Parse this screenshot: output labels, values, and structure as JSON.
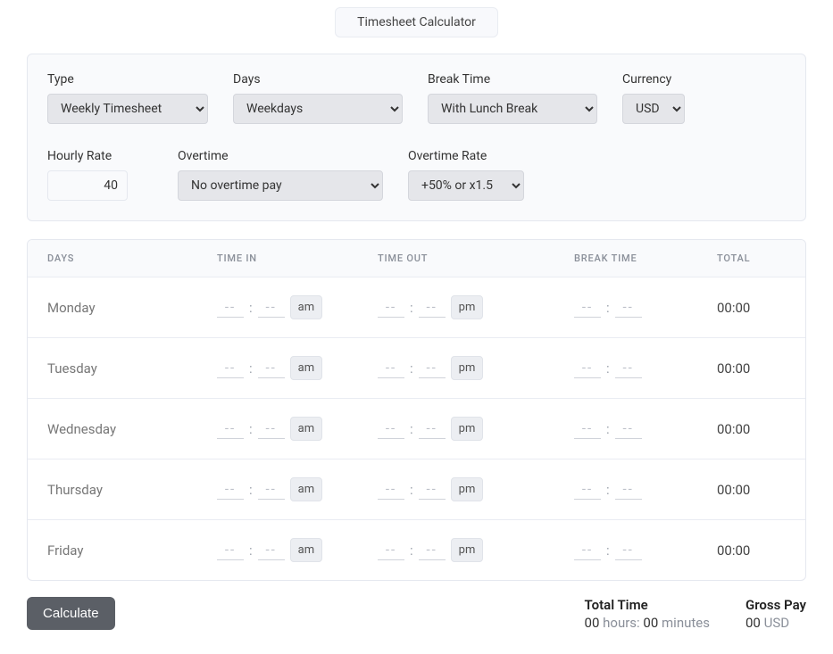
{
  "title": "Timesheet Calculator",
  "controls": {
    "type": {
      "label": "Type",
      "value": "Weekly Timesheet"
    },
    "days": {
      "label": "Days",
      "value": "Weekdays"
    },
    "breaktime": {
      "label": "Break Time",
      "value": "With Lunch Break"
    },
    "currency": {
      "label": "Currency",
      "value": "USD"
    },
    "hourly_rate": {
      "label": "Hourly Rate",
      "value": "40"
    },
    "overtime": {
      "label": "Overtime",
      "value": "No overtime pay"
    },
    "overtime_rate": {
      "label": "Overtime Rate",
      "value": "+50% or x1.5"
    }
  },
  "table": {
    "headers": {
      "days": "Days",
      "time_in": "Time In",
      "time_out": "Time Out",
      "break_time": "Break Time",
      "total": "Total"
    },
    "placeholder": "--",
    "rows": [
      {
        "day": "Monday",
        "in_ampm": "am",
        "out_ampm": "pm",
        "total": "00:00"
      },
      {
        "day": "Tuesday",
        "in_ampm": "am",
        "out_ampm": "pm",
        "total": "00:00"
      },
      {
        "day": "Wednesday",
        "in_ampm": "am",
        "out_ampm": "pm",
        "total": "00:00"
      },
      {
        "day": "Thursday",
        "in_ampm": "am",
        "out_ampm": "pm",
        "total": "00:00"
      },
      {
        "day": "Friday",
        "in_ampm": "am",
        "out_ampm": "pm",
        "total": "00:00"
      }
    ]
  },
  "footer": {
    "calculate": "Calculate",
    "total_time": {
      "label": "Total Time",
      "hours": "00",
      "hours_word": "hours:",
      "minutes": "00",
      "minutes_word": "minutes"
    },
    "gross_pay": {
      "label": "Gross Pay",
      "amount": "00",
      "currency": "USD"
    }
  }
}
